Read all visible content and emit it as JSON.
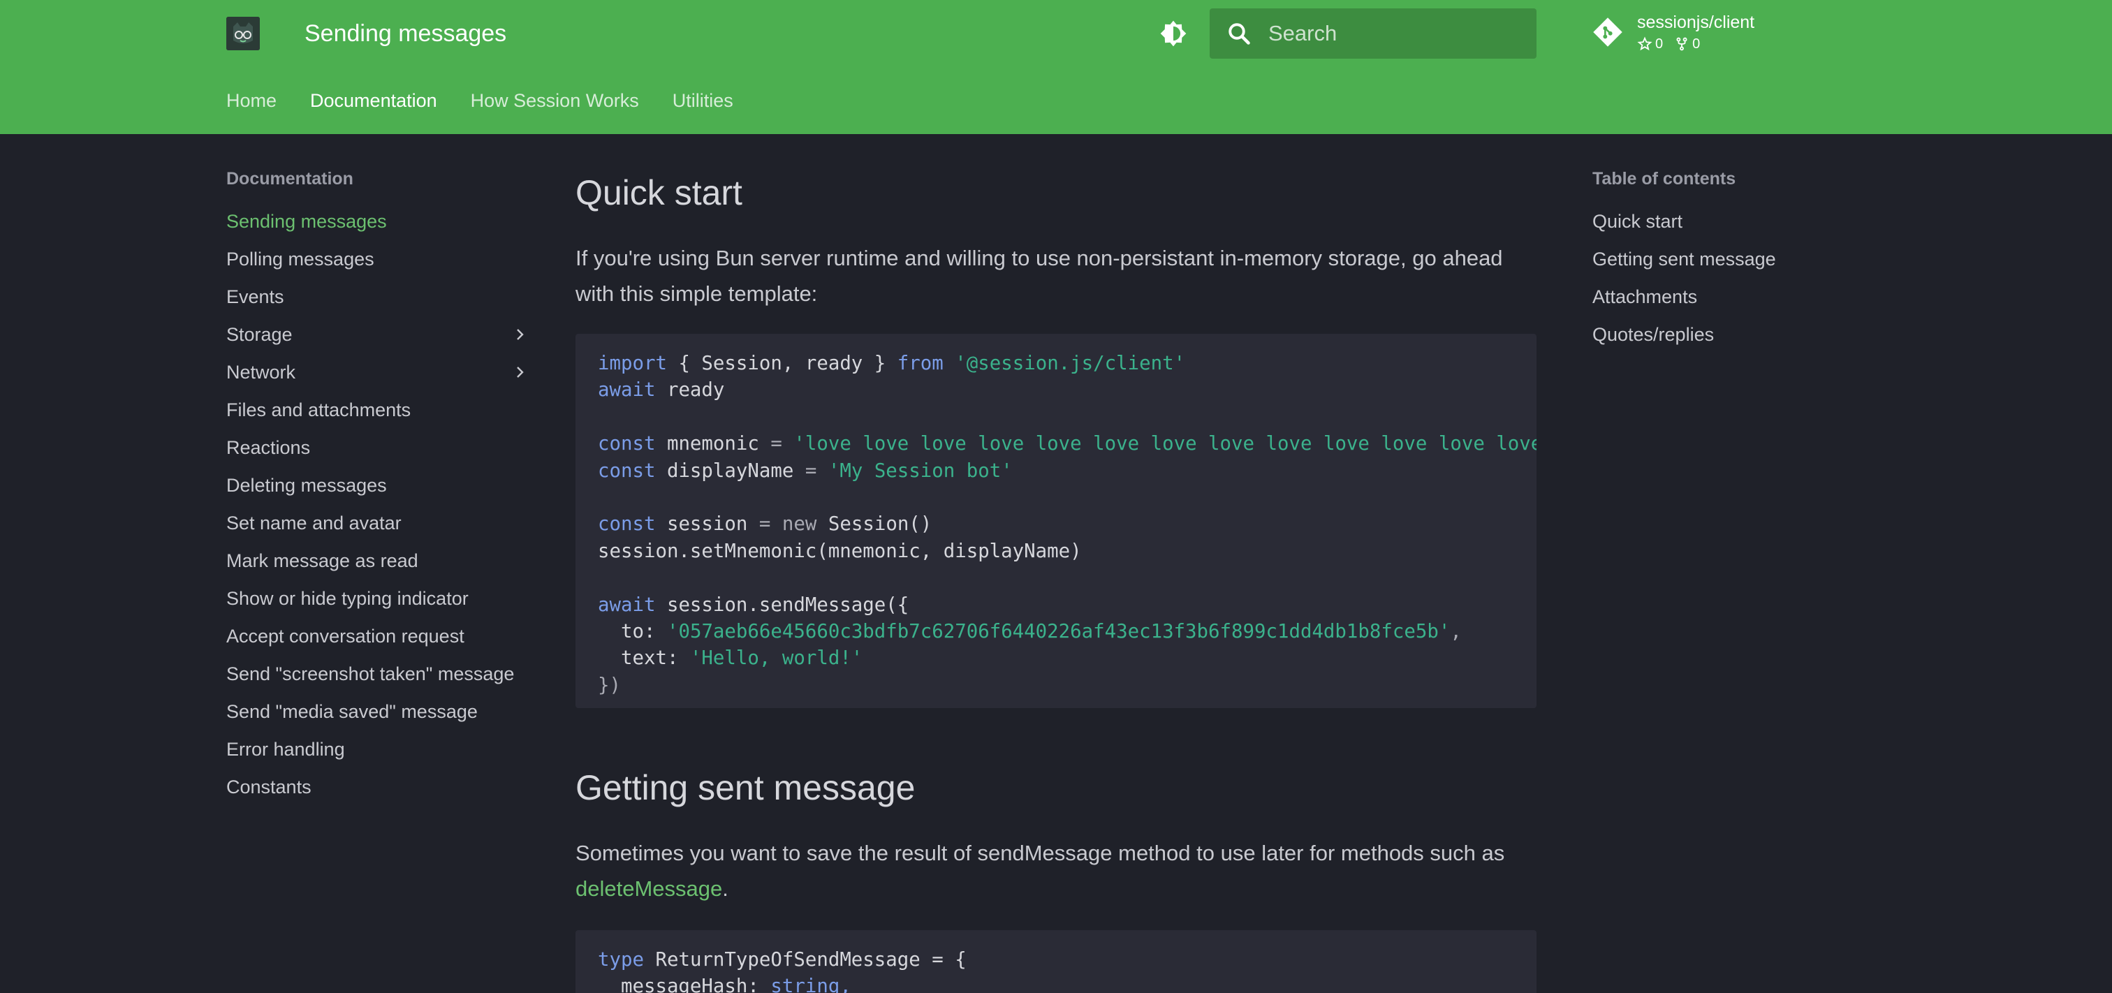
{
  "header": {
    "site_title": "Sending messages",
    "search": {
      "placeholder": "Search"
    },
    "repo": {
      "name": "sessionjs/client",
      "stars": "0",
      "forks": "0"
    },
    "tabs": [
      {
        "label": "Home"
      },
      {
        "label": "Documentation"
      },
      {
        "label": "How Session Works"
      },
      {
        "label": "Utilities"
      }
    ],
    "active_tab": "Documentation"
  },
  "sidebar": {
    "heading": "Documentation",
    "items": [
      {
        "label": "Sending messages"
      },
      {
        "label": "Polling messages"
      },
      {
        "label": "Events"
      },
      {
        "label": "Storage"
      },
      {
        "label": "Network"
      },
      {
        "label": "Files and attachments"
      },
      {
        "label": "Reactions"
      },
      {
        "label": "Deleting messages"
      },
      {
        "label": "Set name and avatar"
      },
      {
        "label": "Mark message as read"
      },
      {
        "label": "Show or hide typing indicator"
      },
      {
        "label": "Accept conversation request"
      },
      {
        "label": "Send \"screenshot taken\" message"
      },
      {
        "label": "Send \"media saved\" message"
      },
      {
        "label": "Error handling"
      },
      {
        "label": "Constants"
      }
    ],
    "active_item": "Sending messages"
  },
  "main": {
    "section1": {
      "title": "Quick start",
      "paragraph": "If you're using Bun server runtime and willing to use non-persistant in-memory storage, go ahead with this simple template:"
    },
    "code1": {
      "import_kw": "import",
      "import_names": "{ Session, ready }",
      "from_kw": "from",
      "module": "'@session.js/client'",
      "await_kw": "await",
      "ready": "ready",
      "const_kw": "const",
      "mnemonic_var": "mnemonic",
      "mnemonic_val": "'love love love love love love love love love love love love love'",
      "displayname_var": "displayName",
      "displayname_val": "'My Session bot'",
      "session_var": "session",
      "new_kw": "new",
      "session_ctor": "Session()",
      "setmnemonic_call": "session.setMnemonic(mnemonic, displayName)",
      "sendmessage_call": "session.sendMessage({",
      "to_key": "to:",
      "to_val": "'057aeb66e45660c3bdfb7c62706f6440226af43ec13f3b6f899c1dd4db1b8fce5b'",
      "text_key": "text:",
      "text_val": "'Hello, world!'",
      "close": "})"
    },
    "section2": {
      "title": "Getting sent message",
      "paragraph_before": "Sometimes you want to save the result of sendMessage method to use later for methods such as ",
      "paragraph_link": "deleteMessage",
      "paragraph_after": "."
    },
    "code2": {
      "type_kw": "type",
      "type_name": "ReturnTypeOfSendMessage = {",
      "field": "messageHash:",
      "field_type": "string,"
    }
  },
  "toc": {
    "heading": "Table of contents",
    "items": [
      {
        "label": "Quick start"
      },
      {
        "label": "Getting sent message"
      },
      {
        "label": "Attachments"
      },
      {
        "label": "Quotes/replies"
      }
    ]
  },
  "colors": {
    "header_bg": "#4caf50",
    "page_bg": "#1f2129",
    "code_bg": "#2a2b36",
    "accent": "#6cc070",
    "keyword": "#7b9de8",
    "string": "#3bb28c"
  }
}
